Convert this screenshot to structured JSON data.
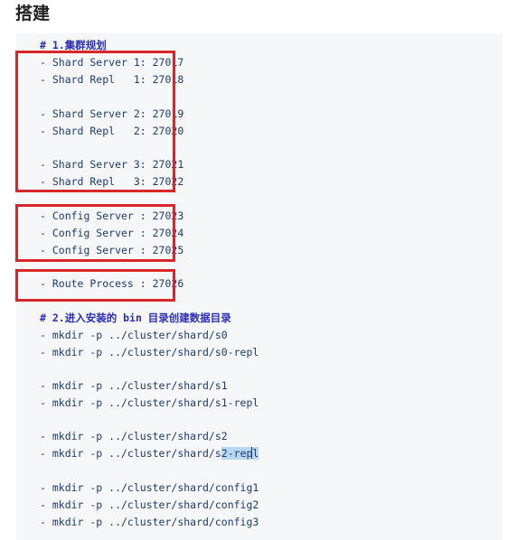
{
  "section": {
    "title": "搭建"
  },
  "code": {
    "comment1": "# 1.集群规划",
    "shard_lines": [
      "- Shard Server 1: 27017",
      "- Shard Repl   1: 27018",
      "- Shard Server 2: 27019",
      "- Shard Repl   2: 27020",
      "- Shard Server 3: 27021",
      "- Shard Repl   3: 27022"
    ],
    "config_lines": [
      "- Config Server : 27023",
      "- Config Server : 27024",
      "- Config Server : 27025"
    ],
    "route_line": "- Route Process : 27026",
    "comment2": "# 2.进入安装的 bin 目录创建数据目录",
    "mkdir_lines": [
      "- mkdir -p ../cluster/shard/s0",
      "- mkdir -p ../cluster/shard/s0-repl",
      "- mkdir -p ../cluster/shard/s1",
      "- mkdir -p ../cluster/shard/s1-repl",
      "- mkdir -p ../cluster/shard/s2",
      "- mkdir -p ../cluster/shard/s",
      "- mkdir -p ../cluster/shard/config1",
      "- mkdir -p ../cluster/shard/config2",
      "- mkdir -p ../cluster/shard/config3"
    ],
    "selected_text": "2-rep",
    "after_cursor": "l"
  },
  "colors": {
    "highlight_box": "#d8262a",
    "selection": "#b8d7f5",
    "code_text": "#1e3a6e",
    "comment_text": "#2c2cb8",
    "code_background": "#f6f7f8"
  }
}
